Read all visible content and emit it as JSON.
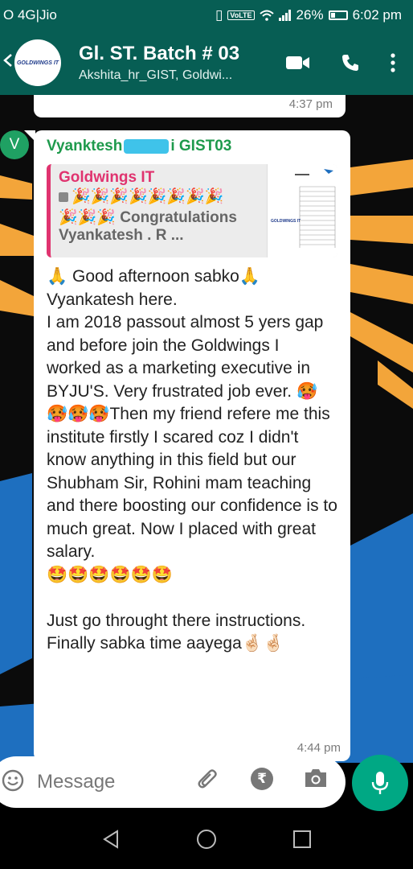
{
  "status_bar": {
    "carrier": "O 4G|Jio",
    "volte": "VoLTE",
    "battery": "26%",
    "time": "6:02 pm"
  },
  "header": {
    "avatar_logo": "GOLDWINGS IT",
    "title": "Gl. ST. Batch # 03",
    "subtitle": "Akshita_hr_GIST, Goldwi...",
    "icons": [
      "video-call-icon",
      "phone-icon",
      "more-vertical-icon"
    ]
  },
  "previous_message": {
    "time": "4:37 pm"
  },
  "message": {
    "sender_avatar_letter": "V",
    "sender_name_start": "Vyanktesh",
    "sender_name_end": "i GIST03",
    "quote": {
      "name": "Goldwings IT",
      "line1": "🎉🎉🎉🎉🎉🎉🎉🎉",
      "line2": "🎉🎉🎉 Congratulations",
      "line3": "Vyankatesh . R ...",
      "thumb_logo": "GOLDWINGS IT"
    },
    "text": "🙏 Good afternoon sabko🙏\nVyankatesh here.\nI am 2018 passout almost 5 yers gap and before join the Goldwings I worked as a marketing executive in BYJU'S. Very frustrated job ever. 🥵🥵🥵🥵Then my friend refere me this institute firstly I scared coz I didn't know anything in this field but our Shubham Sir, Rohini mam teaching and there boosting our confidence is to much great. Now I placed with great salary.\n🤩🤩🤩🤩🤩🤩\n\nJust go throught there instructions. Finally sabka time aayega🤞🏻🤞🏻",
    "time": "4:44 pm"
  },
  "composer": {
    "placeholder": "Message",
    "rupee_symbol": "₹"
  },
  "colors": {
    "header": "#075e54",
    "accent_green": "#00a884",
    "sender_name": "#1e9a4c",
    "quote_accent": "#e0336f"
  }
}
